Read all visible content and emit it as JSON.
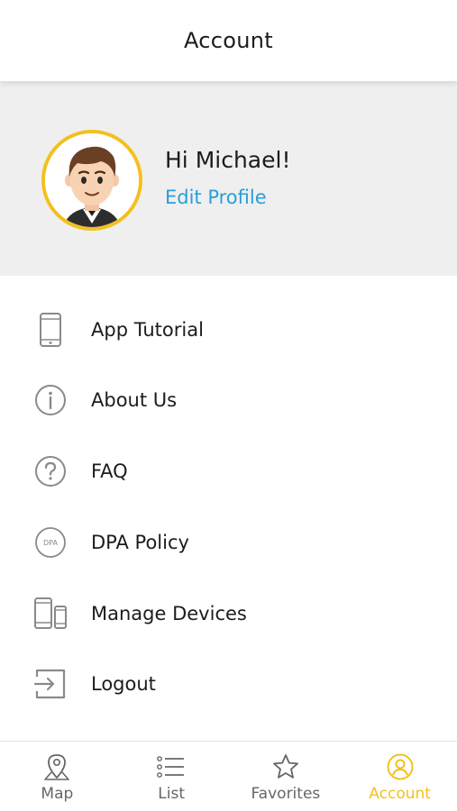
{
  "header": {
    "title": "Account"
  },
  "profile": {
    "greeting": "Hi Michael!",
    "edit_label": "Edit Profile"
  },
  "menu": {
    "items": [
      {
        "label": "App Tutorial",
        "icon": "phone-icon"
      },
      {
        "label": "About Us",
        "icon": "info-icon"
      },
      {
        "label": "FAQ",
        "icon": "question-icon"
      },
      {
        "label": "DPA Policy",
        "icon": "dpa-icon",
        "icon_text": "DPA"
      },
      {
        "label": "Manage Devices",
        "icon": "devices-icon"
      },
      {
        "label": "Logout",
        "icon": "logout-icon"
      }
    ]
  },
  "tabbar": {
    "tabs": [
      {
        "label": "Map",
        "icon": "map-pin-icon",
        "active": false
      },
      {
        "label": "List",
        "icon": "list-icon",
        "active": false
      },
      {
        "label": "Favorites",
        "icon": "star-icon",
        "active": false
      },
      {
        "label": "Account",
        "icon": "account-icon",
        "active": true
      }
    ]
  },
  "colors": {
    "accent": "#f4c01e",
    "link": "#2a9fd6",
    "profile_bg": "#efefef",
    "icon_gray": "#8a8a8a"
  }
}
